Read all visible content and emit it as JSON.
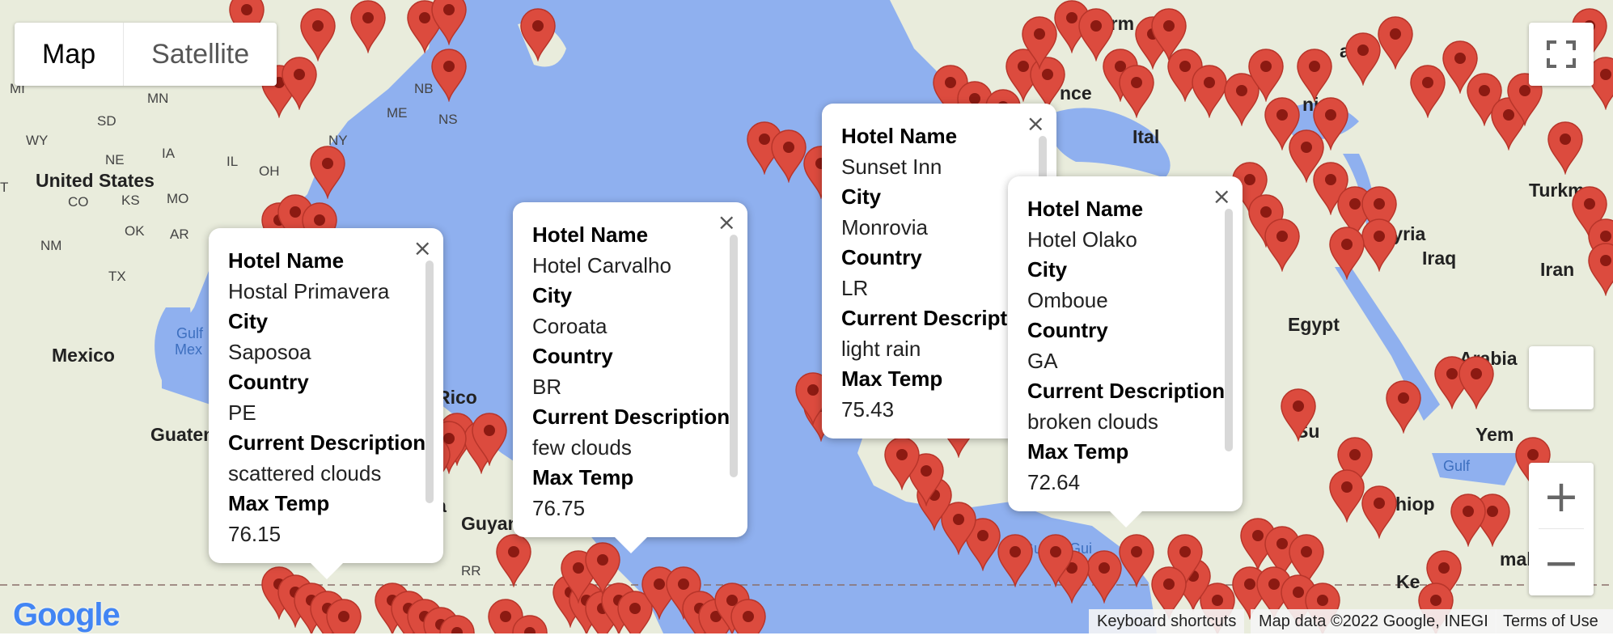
{
  "map_type": {
    "map_label": "Map",
    "satellite_label": "Satellite"
  },
  "labels": {
    "united_states": "United States",
    "mexico": "Mexico",
    "egypt": "Egypt",
    "iraq": "Iraq",
    "iran": "Iran",
    "syria": "Syria",
    "arabia": "Arabia",
    "turkm": "Turkm",
    "guatemala": "Guatem",
    "yemen": "Yem",
    "sudan": "Su",
    "ethiop": "Ethiop",
    "somalia": "malia",
    "kenya": "Ke",
    "guyana": "Guyan",
    "venezuela": "ela",
    "rico": "Rico",
    "germany": "Germ",
    "ukraine": "aine",
    "italy": "Ital",
    "romania": "nia",
    "france": "nce",
    "gulf_mex": "Gulf",
    "gulf_mex2": "Mex",
    "gulf_guinea": "Gulf of Gui",
    "gulf_aden": "Gulf",
    "states": [
      "MN",
      "SD",
      "WY",
      "NE",
      "IA",
      "IL",
      "OH",
      "MO",
      "KS",
      "OK",
      "AR",
      "NM",
      "TX",
      "NY",
      "ME",
      "NB",
      "NS",
      "MI",
      "CO",
      "T",
      "RR"
    ]
  },
  "info_windows": [
    {
      "hotel_name_label": "Hotel Name",
      "hotel_name": "Hostal Primavera",
      "city_label": "City",
      "city": "Saposoa",
      "country_label": "Country",
      "country": "PE",
      "desc_label": "Current Description",
      "desc": "scattered clouds",
      "temp_label": "Max Temp",
      "temp": "76.15"
    },
    {
      "hotel_name_label": "Hotel Name",
      "hotel_name": "Hotel Carvalho",
      "city_label": "City",
      "city": "Coroata",
      "country_label": "Country",
      "country": "BR",
      "desc_label": "Current Description",
      "desc": "few clouds",
      "temp_label": "Max Temp",
      "temp": "76.75"
    },
    {
      "hotel_name_label": "Hotel Name",
      "hotel_name": "Sunset Inn",
      "city_label": "City",
      "city": "Monrovia",
      "country_label": "Country",
      "country": "LR",
      "desc_label": "Current Descriptio",
      "desc": "light rain",
      "temp_label": "Max Temp",
      "temp": "75.43"
    },
    {
      "hotel_name_label": "Hotel Name",
      "hotel_name": "Hotel Olako",
      "city_label": "City",
      "city": "Omboue",
      "country_label": "Country",
      "country": "GA",
      "desc_label": "Current Description",
      "desc": "broken clouds",
      "temp_label": "Max Temp",
      "temp": "72.64"
    }
  ],
  "controls": {
    "zoom_in": "+",
    "zoom_out": "−",
    "close": "×"
  },
  "attribution": {
    "google": "Google",
    "shortcuts": "Keyboard shortcuts",
    "map_data": "Map data ©2022 Google, INEGI",
    "terms": "Terms of Use"
  },
  "colors": {
    "water": "#8fb0ef",
    "land": "#e9ecdc",
    "marker": "#dc4b3e",
    "marker_dot": "#8c1a12"
  }
}
